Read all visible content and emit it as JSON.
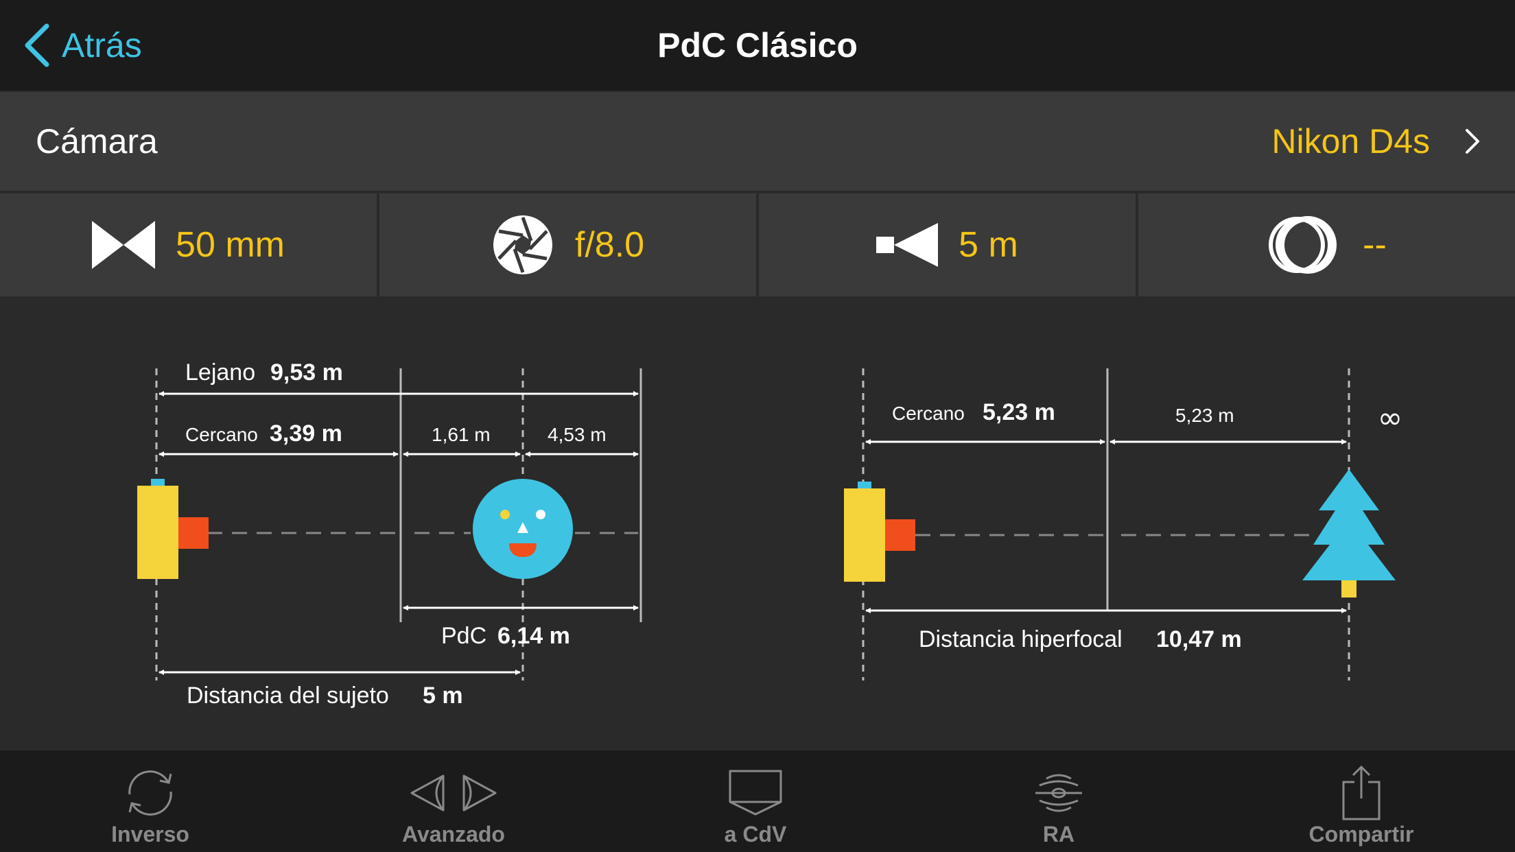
{
  "nav": {
    "back_label": "Atrás",
    "title": "PdC Clásico"
  },
  "camera": {
    "label": "Cámara",
    "value": "Nikon D4s"
  },
  "params": {
    "focal": {
      "icon": "focal-length-icon",
      "value": "50 mm"
    },
    "aperture": {
      "icon": "aperture-icon",
      "value": "f/8.0"
    },
    "distance": {
      "icon": "subject-distance-icon",
      "value": "5 m"
    },
    "filter": {
      "icon": "extender-icon",
      "value": "--"
    }
  },
  "dof_diagram": {
    "far_label": "Lejano",
    "far_value": "9,53 m",
    "near_label": "Cercano",
    "near_value": "3,39 m",
    "front_value": "1,61 m",
    "back_value": "4,53 m",
    "dof_label": "PdC",
    "dof_value": "6,14 m",
    "subject_label": "Distancia del sujeto",
    "subject_value": "5 m"
  },
  "hyper_diagram": {
    "near_label": "Cercano",
    "near_value": "5,23 m",
    "beyond_value": "5,23 m",
    "infinity_symbol": "∞",
    "hyper_label": "Distancia hiperfocal",
    "hyper_value": "10,47 m"
  },
  "tabs": [
    {
      "label": "Inverso",
      "icon": "reverse-icon"
    },
    {
      "label": "Avanzado",
      "icon": "advanced-icon"
    },
    {
      "label": "a CdV",
      "icon": "fov-icon"
    },
    {
      "label": "RA",
      "icon": "ar-icon"
    },
    {
      "label": "Compartir",
      "icon": "share-icon"
    }
  ],
  "colors": {
    "accent": "#3fc3e3",
    "value": "#f5c518",
    "camera_body": "#f5d33a",
    "lens": "#f04e1c",
    "subject": "#3fc3e3",
    "tree": "#3fc3e3"
  }
}
